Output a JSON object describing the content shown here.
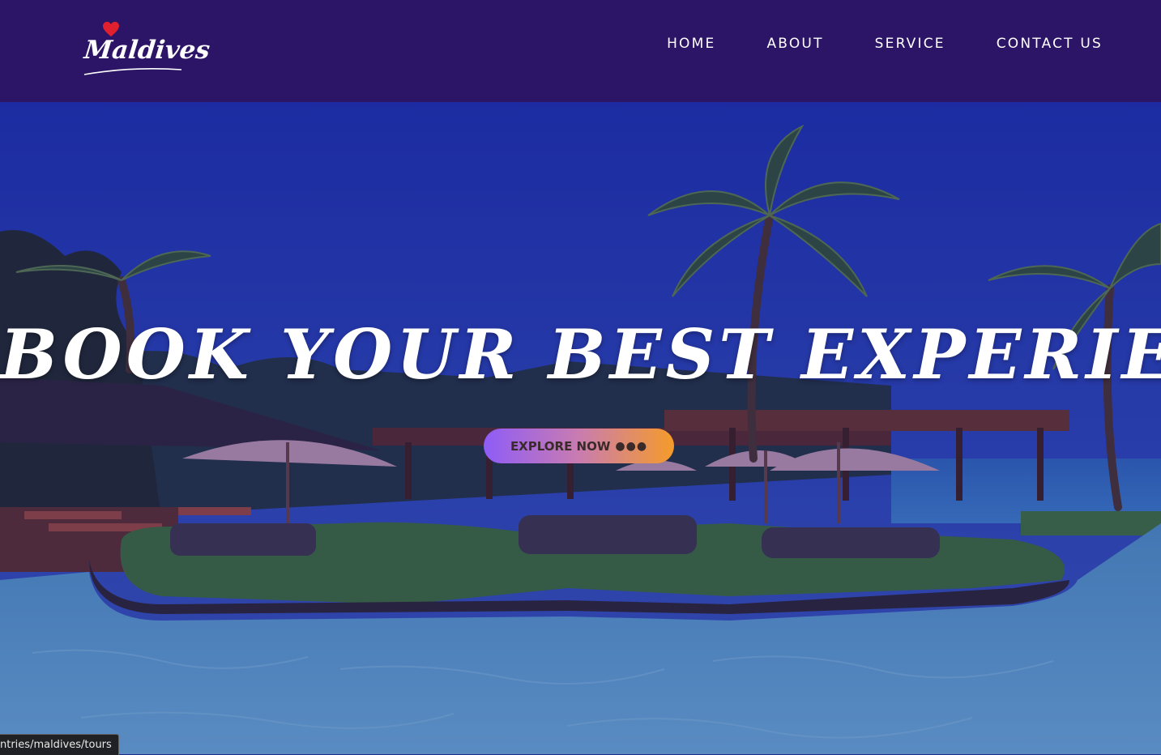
{
  "logo": {
    "text": "Maldives",
    "icon": "heart-icon"
  },
  "nav": {
    "items": [
      {
        "label": "HOME"
      },
      {
        "label": "ABOUT"
      },
      {
        "label": "SERVICE"
      },
      {
        "label": "CONTACT US"
      }
    ]
  },
  "hero": {
    "headline": "BOOK YOUR BEST EXPERIENCE",
    "cta_label": "EXPLORE NOW",
    "cta_icon": "dots-icon"
  },
  "status_bar": {
    "url": "ntries/maldives/tours"
  },
  "colors": {
    "header_bg": "#2c1566",
    "cta_start": "#8e5cf7",
    "cta_end": "#f59b2a",
    "heart": "#e0202e"
  }
}
